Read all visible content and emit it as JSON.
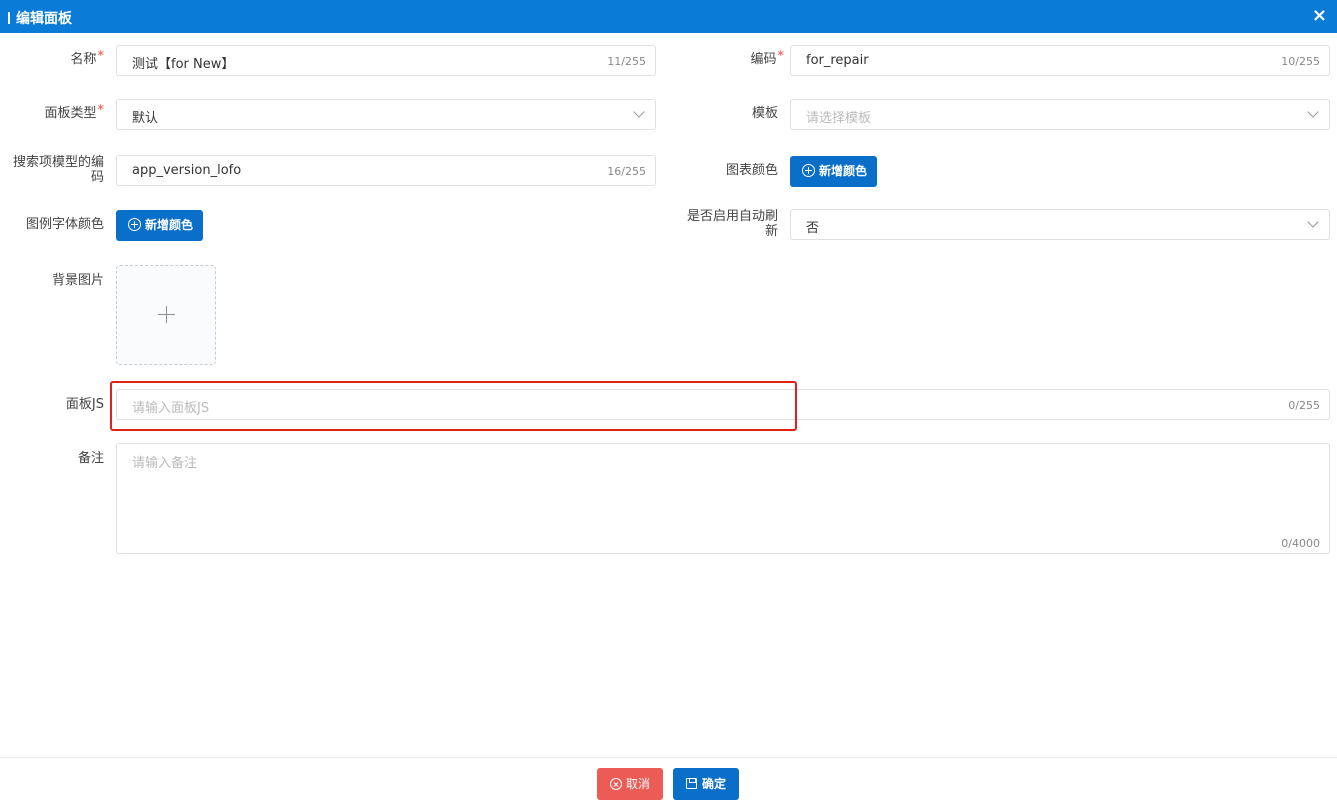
{
  "dialog": {
    "title": "编辑面板",
    "close_icon": "×"
  },
  "form": {
    "name": {
      "label": "名称",
      "required": "*",
      "value": "测试【for New】",
      "count": "11/255"
    },
    "code": {
      "label": "编码",
      "required": "*",
      "value": "for_repair",
      "count": "10/255"
    },
    "panel_type": {
      "label": "面板类型",
      "required": "*",
      "value": "默认"
    },
    "template": {
      "label": "模板",
      "placeholder": "请选择模板"
    },
    "search_model_code": {
      "label_line1": "搜索项模型的编",
      "label_line2": "码",
      "value": "app_version_lofo",
      "count": "16/255"
    },
    "chart_color": {
      "label": "图表颜色",
      "button": "新增颜色"
    },
    "legend_font_color": {
      "label": "图例字体颜色",
      "button": "新增颜色"
    },
    "auto_refresh": {
      "label_line1": "是否启用自动刷",
      "label_line2": "新",
      "value": "否"
    },
    "background_image": {
      "label": "背景图片"
    },
    "panel_js": {
      "label": "面板JS",
      "placeholder": "请输入面板JS",
      "count": "0/255"
    },
    "remark": {
      "label": "备注",
      "placeholder": "请输入备注",
      "count": "0/4000"
    }
  },
  "footer": {
    "cancel_label": "取消",
    "confirm_label": "确定"
  },
  "colors": {
    "header": "#0a7bd6",
    "primary": "#0a6fc9",
    "danger": "#ec5b55",
    "highlight": "#e0201b"
  }
}
